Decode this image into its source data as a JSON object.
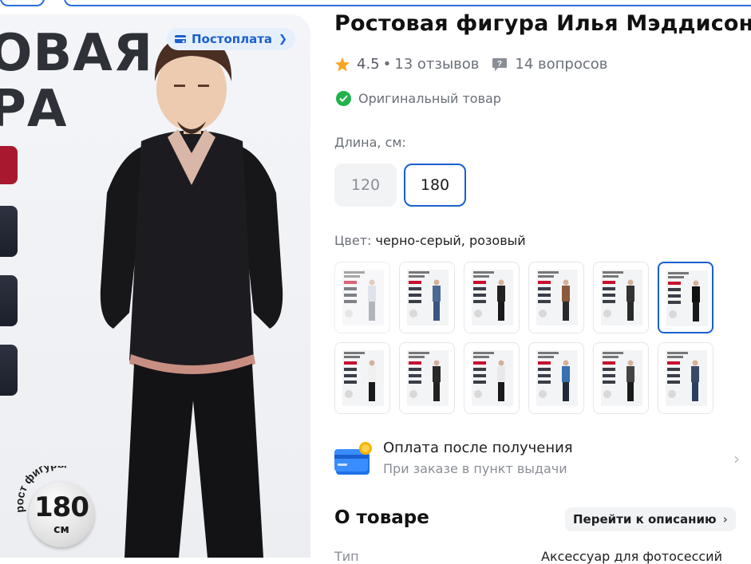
{
  "product": {
    "title": "Ростовая фигура Илья Мэддисон",
    "rating": "4.5",
    "reviews": "13 отзывов",
    "questions": "14 вопросов",
    "original_label": "Оригинальный товар"
  },
  "gallery": {
    "poster_title_lines": [
      "ОВАЯ",
      "РА"
    ],
    "postpay_label": "Постоплата",
    "height_badge": {
      "arc_text": "рост фигуры",
      "value": "180",
      "unit": "см"
    }
  },
  "length": {
    "label": "Длина, см:",
    "options": [
      "120",
      "180"
    ],
    "selected": "180"
  },
  "color": {
    "label": "Цвет:",
    "value": "черно-серый, розовый",
    "thumb_card_text": [
      "РОСТОВАЯ",
      "ФИГУРА"
    ],
    "selected_index": 5
  },
  "payment": {
    "title": "Оплата после получения",
    "subtitle": "При заказе в пункт выдачи"
  },
  "about": {
    "title": "О товаре",
    "goto_label": "Перейти к описанию",
    "spec_label": "Тип",
    "spec_value": "Аксессуар для фотосессий"
  },
  "colors": {
    "accent": "#1a5fcf",
    "check": "#22b24c",
    "star": "#f5a623"
  }
}
